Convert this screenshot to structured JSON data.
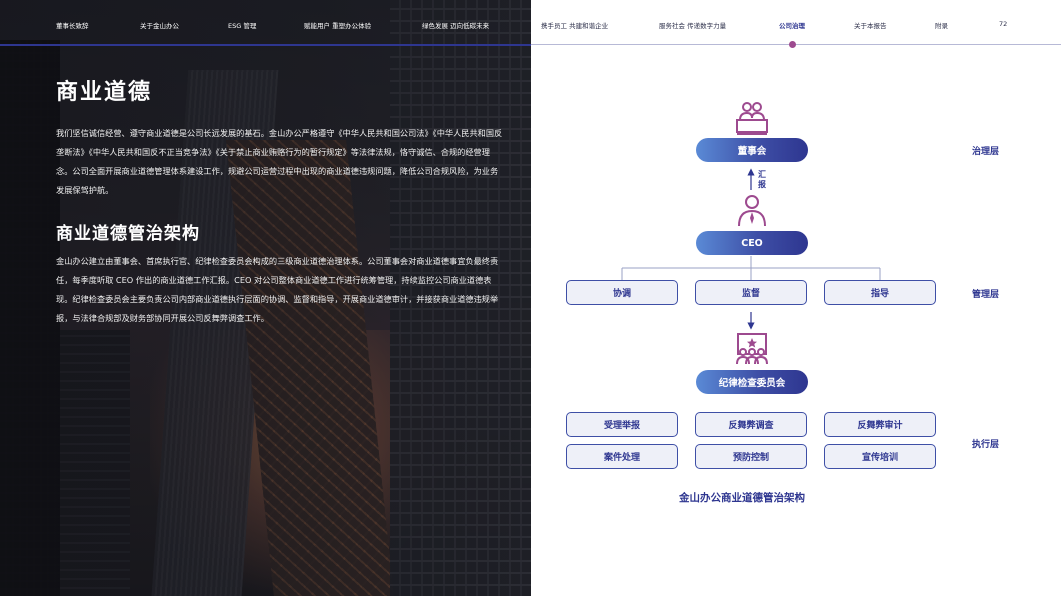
{
  "nav": {
    "items": [
      {
        "label": "董事长致辞",
        "theme": "dark"
      },
      {
        "label": "关于金山办公",
        "theme": "dark"
      },
      {
        "label": "ESG 管理",
        "theme": "dark"
      },
      {
        "label": "赋能用户 重塑办公体验",
        "theme": "dark"
      },
      {
        "label": "绿色发展 迈向低碳未来",
        "theme": "dark"
      },
      {
        "label": "携手员工 共建和谐企业",
        "theme": "light"
      },
      {
        "label": "服务社会 传递数字力量",
        "theme": "light"
      },
      {
        "label": "公司治理",
        "theme": "active"
      },
      {
        "label": "关于本报告",
        "theme": "light"
      },
      {
        "label": "附录",
        "theme": "light"
      }
    ],
    "page_number": "72"
  },
  "left": {
    "title": "商业道德",
    "paragraph1": "我们坚信诚信经营、遵守商业道德是公司长远发展的基石。金山办公严格遵守《中华人民共和国公司法》《中华人民共和国反垄断法》《中华人民共和国反不正当竞争法》《关于禁止商业贿赂行为的暂行规定》等法律法规，恪守诚信、合规的经营理念。公司全面开展商业道德管理体系建设工作，规避公司运营过程中出现的商业道德违规问题，降低公司合规风险，为业务发展保驾护航。",
    "subtitle": "商业道德管治架构",
    "paragraph2": "金山办公建立由董事会、首席执行官、纪律检查委员会构成的三级商业道德治理体系。公司董事会对商业道德事宜负最终责任，每季度听取 CEO 作出的商业道德工作汇报。CEO 对公司整体商业道德工作进行统筹管理，持续监控公司商业道德表现。纪律检查委员会主要负责公司内部商业道德执行层面的协调、监督和指导，开展商业道德审计，并接获商业道德违规举报，与法律合规部及财务部协同开展公司反舞弊调查工作。"
  },
  "chart": {
    "board": "董事会",
    "report_label": "汇报",
    "ceo": "CEO",
    "management": [
      "协调",
      "监督",
      "指导"
    ],
    "committee": "纪律检查委员会",
    "execution_row1": [
      "受理举报",
      "反舞弊调查",
      "反舞弊审计"
    ],
    "execution_row2": [
      "案件处理",
      "预防控制",
      "宣传培训"
    ],
    "layers": {
      "governance": "治理层",
      "management": "管理层",
      "execution": "执行层"
    },
    "caption": "金山办公商业道德管治架构",
    "colors": {
      "primary": "#2e3690",
      "accent": "#9d4a8f",
      "pill_light": "#5a8ad6",
      "box_fill": "#eef0f8"
    }
  }
}
